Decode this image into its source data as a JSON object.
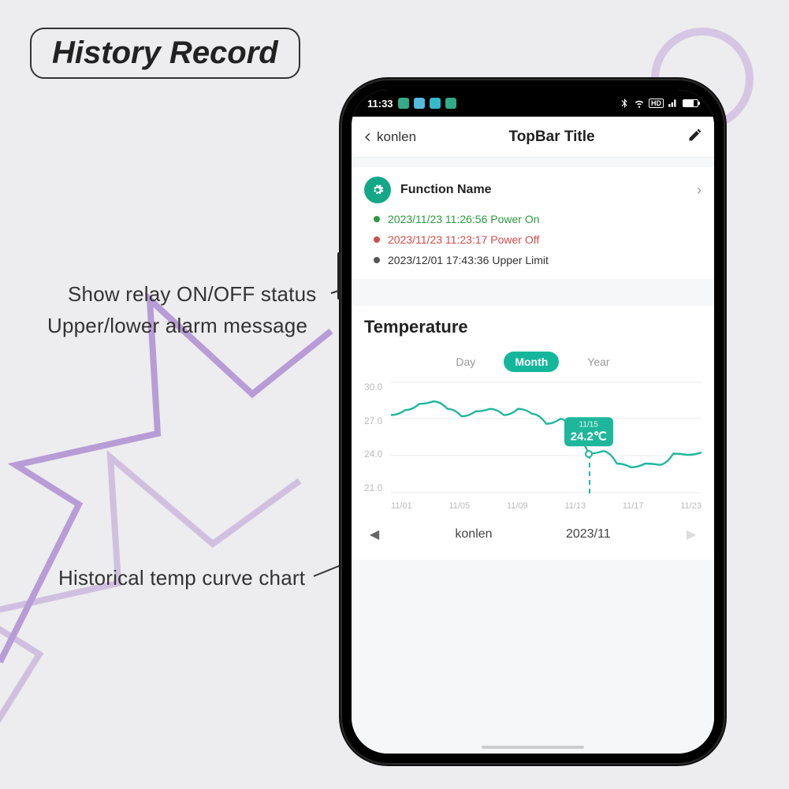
{
  "page_title": "History Record",
  "annotations": {
    "relay_status": "Show relay ON/OFF status",
    "alarm_msg": "Upper/lower alarm message",
    "curve": "Historical temp curve chart"
  },
  "status_bar": {
    "time": "11:33",
    "carrier": "konlen"
  },
  "titlebar": {
    "back_label": "konlen",
    "title": "TopBar Title"
  },
  "function": {
    "label": "Function Name",
    "events": [
      {
        "color": "green",
        "text": "2023/11/23 11:26:56 Power On"
      },
      {
        "color": "red",
        "text": "2023/11/23 11:23:17 Power Off"
      },
      {
        "color": "gray",
        "text": "2023/12/01 17:43:36 Upper Limit"
      }
    ]
  },
  "temp": {
    "heading": "Temperature",
    "tabs": {
      "day": "Day",
      "month": "Month",
      "year": "Year",
      "active": "month"
    },
    "tooltip": {
      "date": "11/15",
      "value": "24.2℃"
    },
    "footer": {
      "device": "konlen",
      "period": "2023/11"
    }
  },
  "chart_data": {
    "type": "line",
    "title": "Temperature",
    "xlabel": "",
    "ylabel": "",
    "ylim": [
      21.0,
      30.0
    ],
    "y_ticks": [
      30.0,
      27.0,
      24.0,
      21.0
    ],
    "x_ticks": [
      "11/01",
      "11/05",
      "11/09",
      "11/13",
      "11/17",
      "11/23"
    ],
    "x": [
      "11/01",
      "11/02",
      "11/03",
      "11/04",
      "11/05",
      "11/06",
      "11/07",
      "11/08",
      "11/09",
      "11/10",
      "11/11",
      "11/12",
      "11/13",
      "11/14",
      "11/15",
      "11/16",
      "11/17",
      "11/18",
      "11/19",
      "11/20",
      "11/21",
      "11/22",
      "11/23"
    ],
    "values": [
      27.3,
      27.7,
      28.2,
      28.4,
      27.8,
      27.2,
      27.6,
      27.8,
      27.3,
      27.8,
      27.4,
      26.6,
      27.0,
      25.6,
      24.2,
      24.4,
      23.4,
      23.1,
      23.4,
      23.3,
      24.2,
      24.1,
      24.3
    ],
    "highlight": {
      "x": "11/15",
      "value": 24.2
    }
  }
}
